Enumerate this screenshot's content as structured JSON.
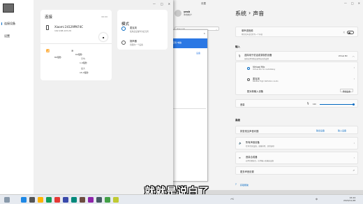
{
  "settings": {
    "window_title": "设置",
    "user_name": "yesh",
    "user_account": "本地帐户",
    "search_placeholder": "查找设置",
    "breadcrumb_parent": "系统",
    "breadcrumb_sep": "›",
    "breadcrumb_current": "声音",
    "mono_title": "单声道音频",
    "mono_desc": "将左右声道合并为一个声道",
    "mono_state": "关",
    "input_section": "输入",
    "choose_input_title": "选择用于说话或录制的设备",
    "choose_input_desc": "某些应用可能会使用自己的设置",
    "input_device_selected": "Virtual Mic",
    "input_devices": [
      {
        "name": "Virtual Mic",
        "desc": "Virtual Mic for AudioRelay"
      },
      {
        "name": "麦克风",
        "desc": "Realtek High Definition Audio"
      }
    ],
    "pair_input_label": "配对新输入设备",
    "add_device_button": "添加设备",
    "volume_label": "音量",
    "volume_value": "100",
    "volume_percent": 100,
    "advanced_section": "高级",
    "troubleshoot_label": "排查常见声音问题",
    "output_devices_link": "输出设备",
    "input_devices_link": "输入设备",
    "all_devices_title": "所有声音设备",
    "all_devices_desc": "打开/关闭设备、故障排除、其他选项",
    "mixer_title": "音量合成器",
    "mixer_desc": "应用音量混合、应用输入和输出设备",
    "more_settings": "更多声音设置",
    "get_help": "获取帮助"
  },
  "phone_window": {
    "title": "已连接到 电脑",
    "tab": "设备",
    "rows": [
      "NC",
      "...",
      "设置"
    ]
  },
  "dialog": {
    "nav": [
      {
        "label": "连接设备",
        "active": true
      },
      {
        "label": "设置",
        "active": false
      }
    ],
    "connection": {
      "title": "连接",
      "time": "00:00",
      "device_name": "Xiaomi 24129PN74C",
      "device_ip": "192.168.123.29",
      "stats": {
        "signal_label": "89毫秒",
        "wifi_label": "64毫秒",
        "avg_label": "平均",
        "avg_value": "1.9毫秒",
        "max_label": "最大",
        "max_value": "15.3毫秒"
      }
    },
    "mode": {
      "title": "模式",
      "options": [
        {
          "label": "麦克风",
          "desc": "使用此设备作为麦克风",
          "selected": true
        },
        {
          "label": "扬声器",
          "desc": "音频向一个设备",
          "selected": false
        }
      ]
    }
  },
  "taskbar": {
    "weather": "7℃",
    "lang": "中",
    "time": "16:24",
    "date": "2024/11/28"
  },
  "caption": "就就是说白了"
}
